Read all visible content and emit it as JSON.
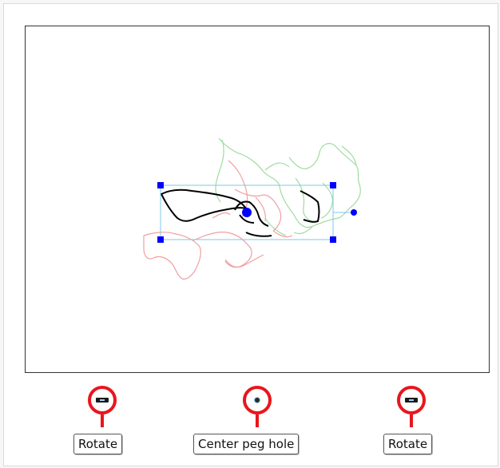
{
  "callouts": {
    "left": {
      "label": "Rotate",
      "icon": "rotate-bar-icon"
    },
    "center": {
      "label": "Center peg hole",
      "icon": "peg-hole-icon"
    },
    "right": {
      "label": "Rotate",
      "icon": "rotate-bar-icon"
    }
  },
  "colors": {
    "accent_red": "#e8161d",
    "handle_blue": "#0000ff",
    "bbox_blue": "#7ec8ea",
    "onion_red": "#f0a0a0",
    "onion_green": "#9fdc9f",
    "drawing_black": "#000000"
  }
}
